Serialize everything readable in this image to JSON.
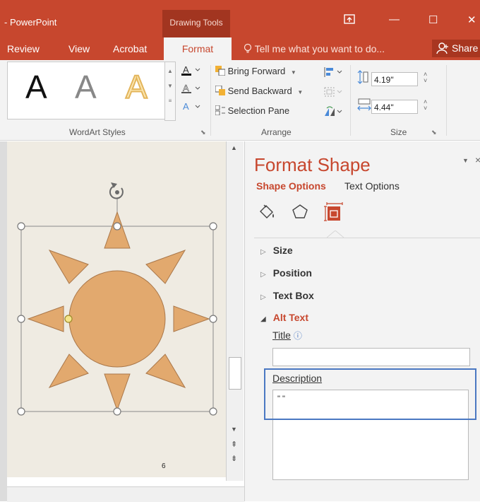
{
  "titlebar": {
    "app_title": "- PowerPoint",
    "context_group": "Drawing Tools",
    "buttons": [
      "restore",
      "minimize",
      "maximize",
      "close"
    ],
    "close_glyph": "✕",
    "min_glyph": "—",
    "max_glyph": "☐"
  },
  "tabs": {
    "review": "Review",
    "view": "View",
    "acrobat": "Acrobat",
    "format": "Format",
    "tell_me": "Tell me what you want to do...",
    "share": "Share"
  },
  "ribbon": {
    "wordart": {
      "letters": [
        "A",
        "A",
        "A"
      ],
      "group_label": "WordArt Styles"
    },
    "arrange": {
      "bring_forward": "Bring Forward",
      "send_backward": "Send Backward",
      "selection_pane": "Selection Pane",
      "group_label": "Arrange"
    },
    "size": {
      "height": "4.19\"",
      "width": "4.44\"",
      "group_label": "Size"
    }
  },
  "slide": {
    "page_number": "6",
    "shape": "sun"
  },
  "pane": {
    "title": "Format Shape",
    "options": {
      "shape": "Shape Options",
      "text": "Text Options"
    },
    "sections": {
      "size": "Size",
      "position": "Position",
      "text_box": "Text Box",
      "alt_text": "Alt Text"
    },
    "alt_text": {
      "title_label": "Title",
      "title_value": "",
      "description_label": "Description",
      "description_value": "\" \""
    }
  },
  "colors": {
    "accent": "#c7472e",
    "sun_fill": "#e2a96e",
    "sun_stroke": "#a9774a",
    "highlight": "#4a78c2"
  }
}
